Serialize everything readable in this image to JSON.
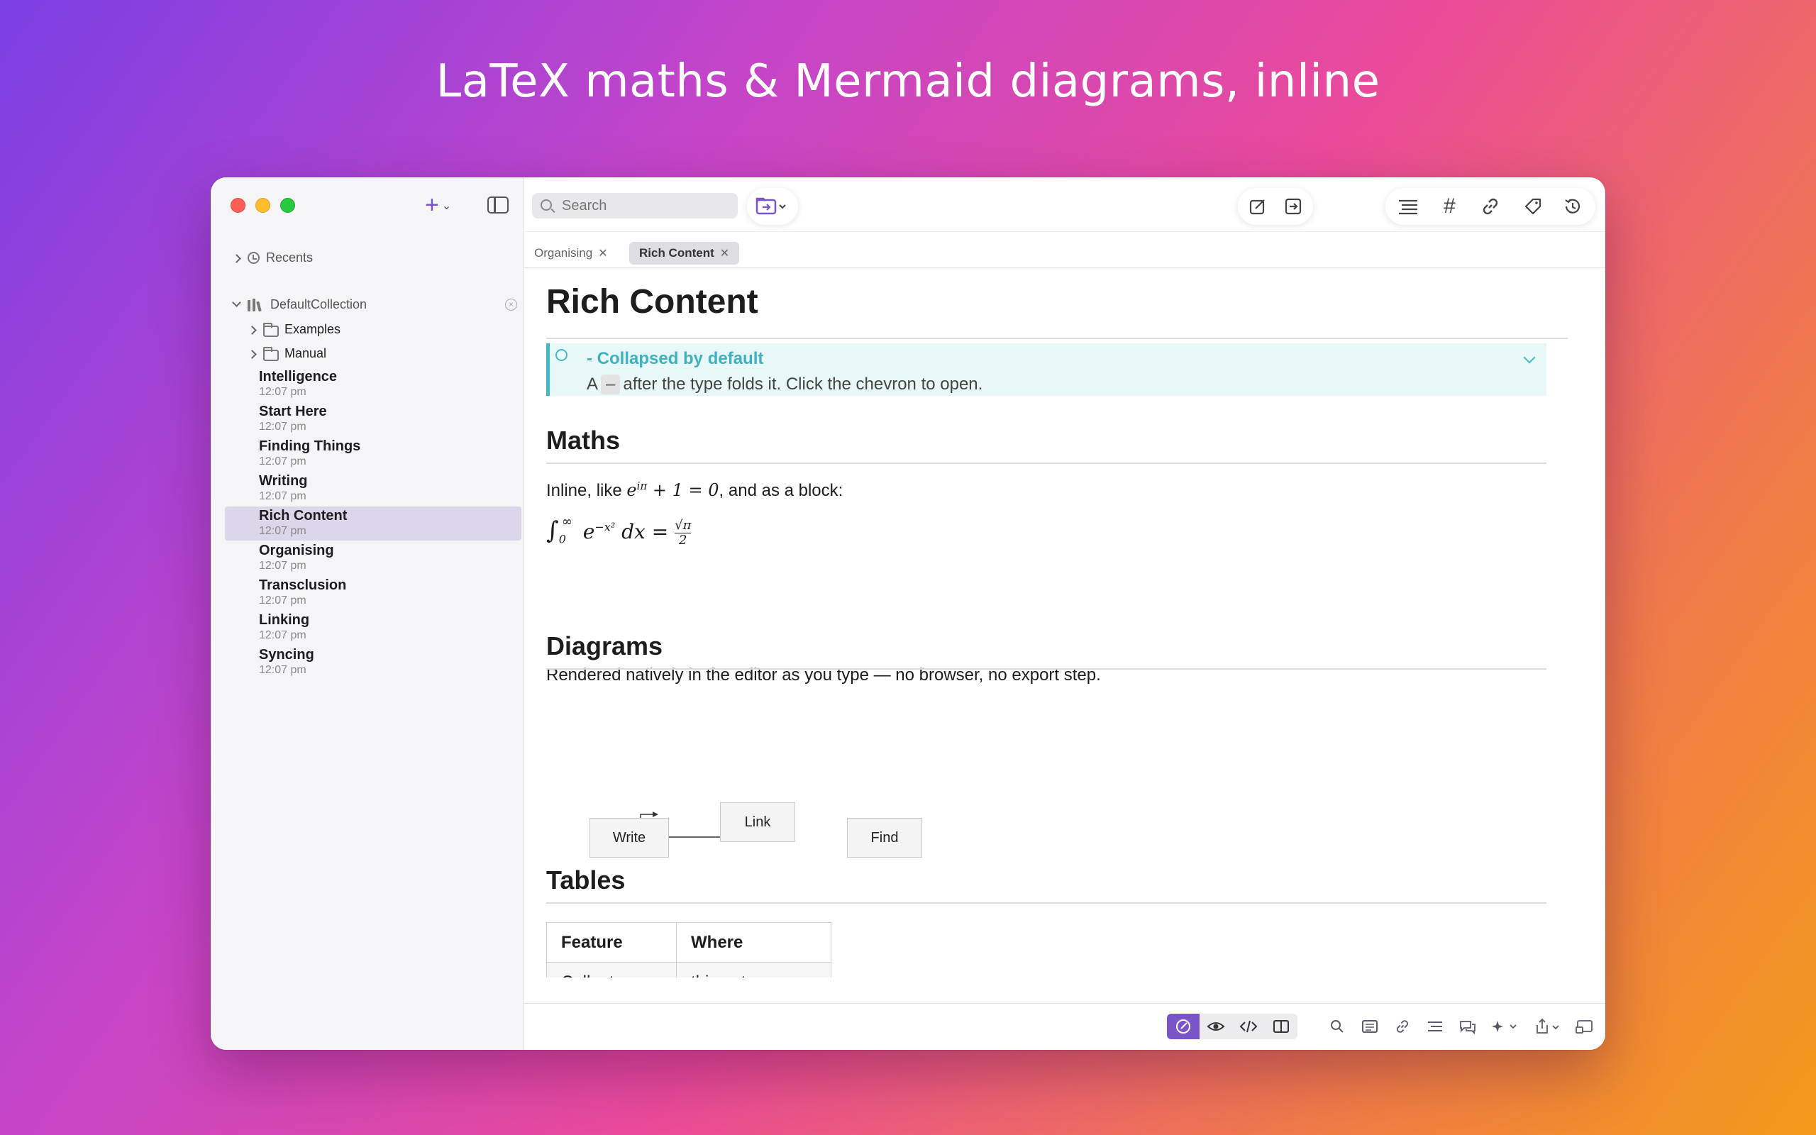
{
  "headline": "LaTeX maths & Mermaid diagrams, inline",
  "colors": {
    "accent": "#7a55c8",
    "callout": "#45b8c5",
    "selection": "#ddd6ea"
  },
  "sidebar": {
    "recents_label": "Recents",
    "collection_label": "DefaultCollection",
    "folders": [
      {
        "label": "Examples",
        "icon": "folder-icon"
      },
      {
        "label": "Manual",
        "icon": "folder-icon"
      }
    ],
    "notes": [
      {
        "title": "Intelligence",
        "time": "12:07 pm"
      },
      {
        "title": "Start Here",
        "time": "12:07 pm"
      },
      {
        "title": "Finding Things",
        "time": "12:07 pm"
      },
      {
        "title": "Writing",
        "time": "12:07 pm"
      },
      {
        "title": "Rich Content",
        "time": "12:07 pm",
        "selected": true
      },
      {
        "title": "Organising",
        "time": "12:07 pm"
      },
      {
        "title": "Transclusion",
        "time": "12:07 pm"
      },
      {
        "title": "Linking",
        "time": "12:07 pm"
      },
      {
        "title": "Syncing",
        "time": "12:07 pm"
      }
    ]
  },
  "toolbar": {
    "search_placeholder": "Search",
    "right_icons": [
      "outline-icon",
      "hashtag-icon",
      "link-icon",
      "tag-icon",
      "history-icon"
    ]
  },
  "tabs": [
    {
      "label": "Organising",
      "active": false
    },
    {
      "label": "Rich Content",
      "active": true
    }
  ],
  "doc": {
    "title": "Rich Content",
    "callout": {
      "title": "- Collapsed by default",
      "body_pre": "A",
      "body_kbd": "–",
      "body_post": "after the type folds it. Click the chevron to open."
    },
    "maths_heading": "Maths",
    "inline_pre": "Inline, like",
    "inline_post": ", and as a block:",
    "rendered_text": "Rendered natively in the editor as you type — no browser, no export step.",
    "diagrams_heading": "Diagrams",
    "diagram_nodes": [
      "Write",
      "Link",
      "Find"
    ],
    "tables_heading": "Tables",
    "table": {
      "headers": [
        "Feature",
        "Where"
      ],
      "rows": [
        [
          "Callouts",
          "this note"
        ]
      ]
    }
  }
}
